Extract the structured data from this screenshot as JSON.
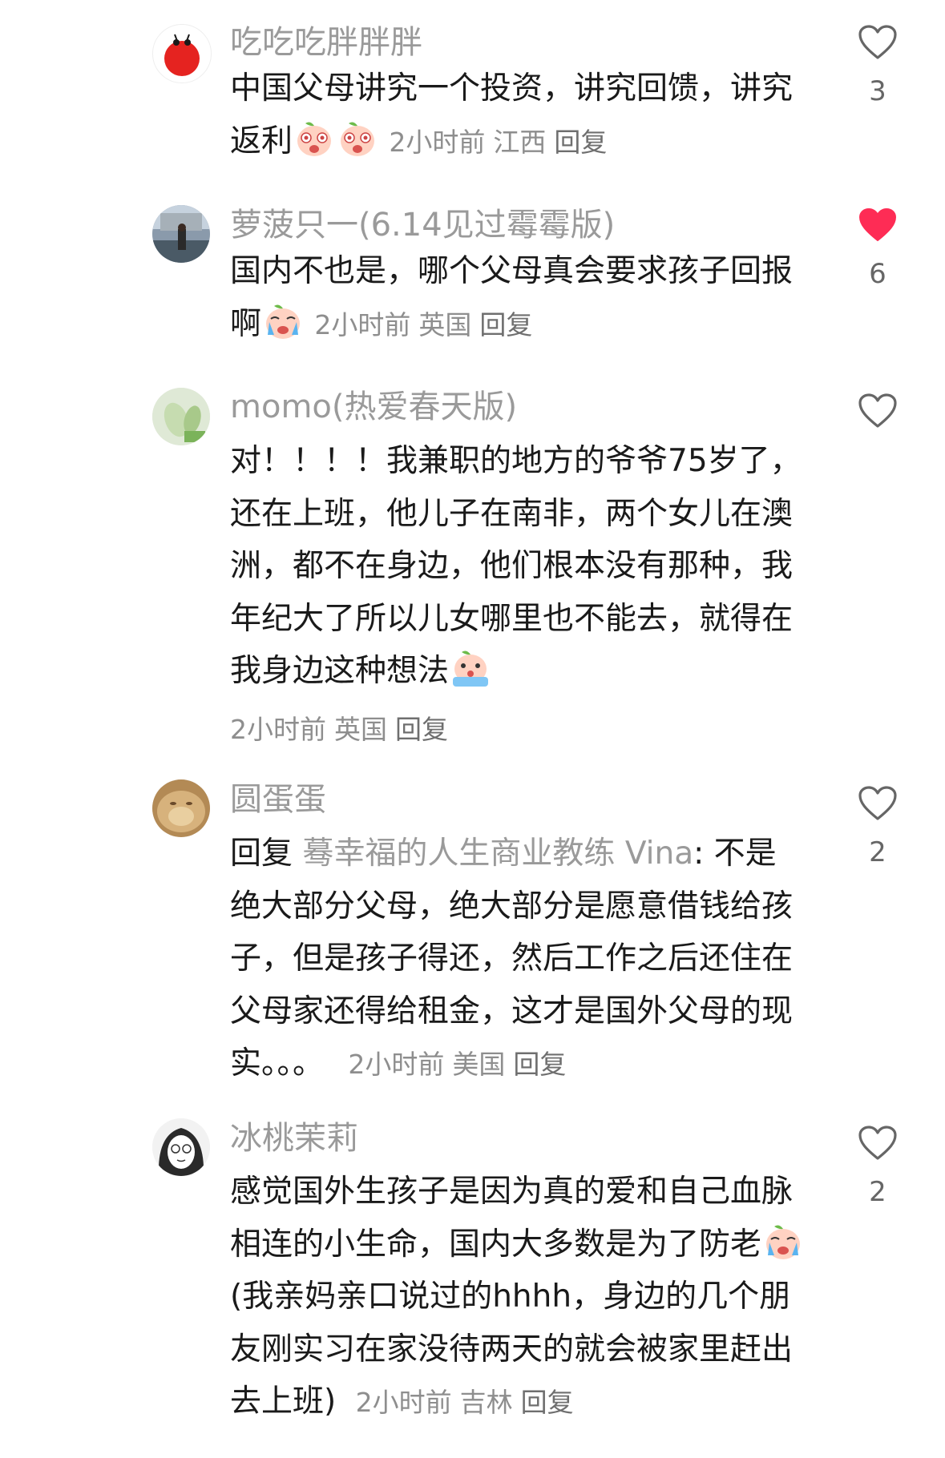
{
  "comments": [
    {
      "username": "吃吃吃胖胖胖",
      "text": "中国父母讲究一个投资，讲究回馈，讲究返利",
      "emojis": [
        "crying-peach-emoji",
        "crying-peach-emoji"
      ],
      "time": "2小时前",
      "location": "江西",
      "reply": "回复",
      "likes": "3",
      "liked": false
    },
    {
      "username": "萝菠只一(6.14见过霉霉版)",
      "text": "国内不也是，哪个父母真会要求孩子回报啊",
      "emojis": [
        "sobbing-peach-emoji"
      ],
      "time": "2小时前",
      "location": "英国",
      "reply": "回复",
      "likes": "6",
      "liked": true
    },
    {
      "username": "momo(热爱春天版)",
      "text": "对！！！！我兼职的地方的爷爷75岁了，还在上班，他儿子在南非，两个女儿在澳洲，都不在身边，他们根本没有那种，我年纪大了所以儿女哪里也不能去，就得在我身边这种想法",
      "emojis": [
        "tears-peach-emoji"
      ],
      "time": "2小时前",
      "location": "英国",
      "reply": "回复",
      "likes": "",
      "liked": false
    },
    {
      "username": "圆蛋蛋",
      "reply_prefix": "回复",
      "reply_target": "蓦幸福的人生商业教练 Vina",
      "text": ": 不是绝大部分父母，绝大部分是愿意借钱给孩子，但是孩子得还，然后工作之后还住在父母家还得给租金，这才是国外父母的现实。。。",
      "time": "2小时前",
      "location": "美国",
      "reply": "回复",
      "likes": "2",
      "liked": false
    },
    {
      "username": "冰桃茉莉",
      "text_before_emoji": "感觉国外生孩子是因为真的爱和自己血脉相连的小生命，国内大多数是为了防老",
      "emojis": [
        "sobbing-peach-emoji"
      ],
      "text_after_emoji": "(我亲妈亲口说过的hhhh，身边的几个朋友刚实习在家没待两天的就会被家里赶出去上班)",
      "time": "2小时前",
      "location": "吉林",
      "reply": "回复",
      "likes": "2",
      "liked": false
    }
  ],
  "colors": {
    "username": "#9a9a9a",
    "text": "#1a1a1a",
    "meta": "#8e8e8e",
    "like_outline": "#666666",
    "like_filled": "#fe2c55"
  }
}
